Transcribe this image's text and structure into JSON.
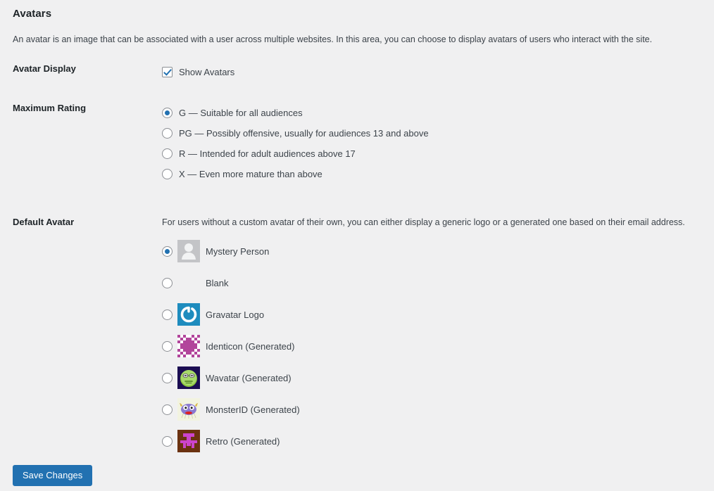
{
  "page": {
    "title": "Avatars",
    "intro": "An avatar is an image that can be associated with a user across multiple websites. In this area, you can choose to display avatars of users who interact with the site."
  },
  "avatar_display": {
    "label": "Avatar Display",
    "checkbox_label": "Show Avatars",
    "checked": true
  },
  "maximum_rating": {
    "label": "Maximum Rating",
    "options": [
      {
        "value": "G",
        "label": "G — Suitable for all audiences",
        "selected": true
      },
      {
        "value": "PG",
        "label": "PG — Possibly offensive, usually for audiences 13 and above",
        "selected": false
      },
      {
        "value": "R",
        "label": "R — Intended for adult audiences above 17",
        "selected": false
      },
      {
        "value": "X",
        "label": "X — Even more mature than above",
        "selected": false
      }
    ]
  },
  "default_avatar": {
    "label": "Default Avatar",
    "description": "For users without a custom avatar of their own, you can either display a generic logo or a generated one based on their email address.",
    "options": [
      {
        "value": "mystery",
        "label": "Mystery Person",
        "icon": "mystery-person-avatar",
        "selected": true
      },
      {
        "value": "blank",
        "label": "Blank",
        "icon": "blank-avatar",
        "selected": false
      },
      {
        "value": "gravatar",
        "label": "Gravatar Logo",
        "icon": "gravatar-logo-avatar",
        "selected": false
      },
      {
        "value": "identicon",
        "label": "Identicon (Generated)",
        "icon": "identicon-avatar",
        "selected": false
      },
      {
        "value": "wavatar",
        "label": "Wavatar (Generated)",
        "icon": "wavatar-avatar",
        "selected": false
      },
      {
        "value": "monsterid",
        "label": "MonsterID (Generated)",
        "icon": "monsterid-avatar",
        "selected": false
      },
      {
        "value": "retro",
        "label": "Retro (Generated)",
        "icon": "retro-avatar",
        "selected": false
      }
    ]
  },
  "submit": {
    "save_label": "Save Changes"
  },
  "colors": {
    "accent": "#2271b1",
    "background": "#f0f0f1",
    "text": "#3c434a",
    "heading": "#1d2327",
    "gravatar_blue": "#1e8cbe",
    "identicon_magenta": "#b2459b",
    "wavatar_navy": "#1b0d52",
    "wavatar_green": "#8cc63f",
    "monster_purple": "#8b7ad0",
    "retro_brown": "#6b3210",
    "retro_magenta": "#cc44cc"
  }
}
